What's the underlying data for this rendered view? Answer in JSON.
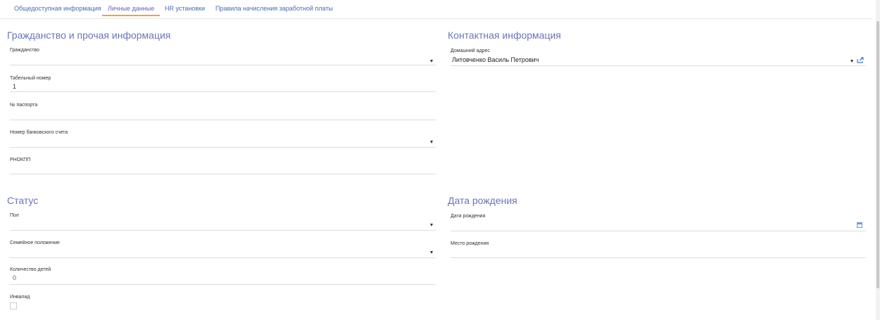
{
  "tabs": [
    {
      "label": "Общедоступная информация"
    },
    {
      "label": "Личные данные"
    },
    {
      "label": "HR установки"
    },
    {
      "label": "Правила начисления заработной платы"
    }
  ],
  "sections": {
    "citizenship": {
      "title": "Гражданство и прочая информация",
      "fields": {
        "citizenship": {
          "label": "Гражданство",
          "value": ""
        },
        "personnel_number": {
          "label": "Табельный номер",
          "value": "1"
        },
        "passport": {
          "label": "№ паспорта",
          "value": ""
        },
        "bank_account": {
          "label": "Номер банковского счета",
          "value": ""
        },
        "rnokpp": {
          "label": "РНОКПП",
          "value": ""
        }
      }
    },
    "contact": {
      "title": "Контактная информация",
      "fields": {
        "home_address": {
          "label": "Домашний адрес",
          "value": "Литовченко Василь Петрович"
        }
      }
    },
    "status": {
      "title": "Статус",
      "fields": {
        "gender": {
          "label": "Пол",
          "value": ""
        },
        "marital": {
          "label": "Семейное положение",
          "value": ""
        },
        "children": {
          "label": "Количество детей",
          "value": "0"
        },
        "disabled": {
          "label": "Инвалид",
          "checked": false
        }
      }
    },
    "birth": {
      "title": "Дата рождения",
      "fields": {
        "birth_date": {
          "label": "Дата рождения",
          "value": ""
        },
        "birth_place": {
          "label": "Место рождения",
          "value": ""
        }
      }
    }
  },
  "icons": {
    "dropdown": "chevron-down-icon",
    "open_record": "external-link-icon",
    "calendar": "calendar-icon"
  },
  "colors": {
    "accent_tab_underline": "#e8a44a",
    "section_title": "#6a75b8",
    "link": "#4a6bb0"
  }
}
